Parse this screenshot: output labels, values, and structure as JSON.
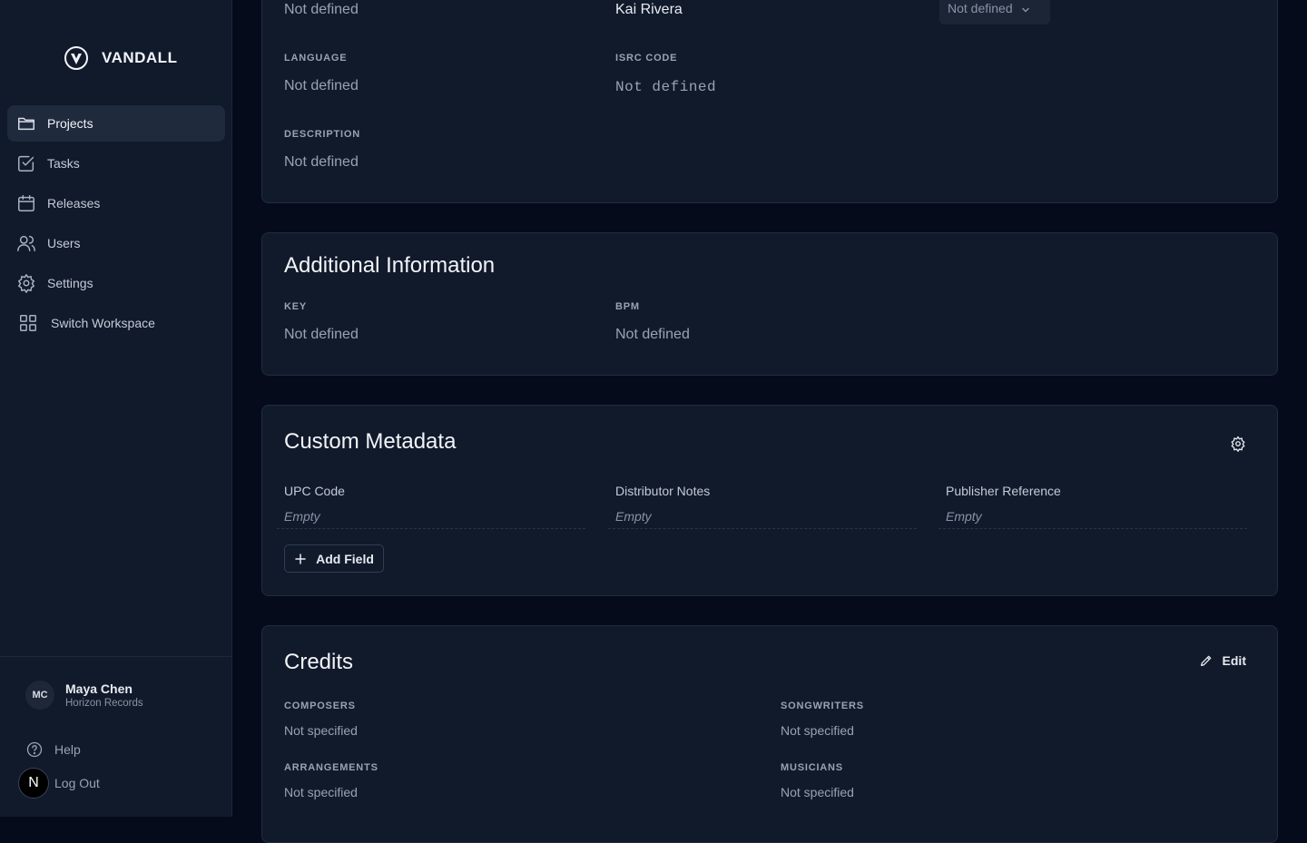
{
  "app": {
    "name": "VANDALL"
  },
  "sidebar": {
    "items": [
      {
        "label": "Projects",
        "icon": "folder-icon",
        "active": true
      },
      {
        "label": "Tasks",
        "icon": "checkbox-icon"
      },
      {
        "label": "Releases",
        "icon": "calendar-icon"
      },
      {
        "label": "Users",
        "icon": "users-icon"
      },
      {
        "label": "Settings",
        "icon": "gear-icon"
      },
      {
        "label": "Switch Workspace",
        "icon": "grid-icon"
      }
    ],
    "user": {
      "initials": "MC",
      "name": "Maya Chen",
      "org": "Horizon Records"
    },
    "help_label": "Help",
    "logout_label": "Log Out",
    "badge": "N"
  },
  "details": {
    "top_row": {
      "col1": "Not defined",
      "col2": "Kai Rivera",
      "select": "Not defined"
    },
    "language": {
      "label": "LANGUAGE",
      "value": "Not defined"
    },
    "isrc": {
      "label": "ISRC CODE",
      "value": "Not defined"
    },
    "description": {
      "label": "DESCRIPTION",
      "value": "Not defined"
    }
  },
  "additional": {
    "title": "Additional Information",
    "key": {
      "label": "KEY",
      "value": "Not defined"
    },
    "bpm": {
      "label": "BPM",
      "value": "Not defined"
    }
  },
  "custom": {
    "title": "Custom Metadata",
    "fields": [
      {
        "label": "UPC Code",
        "value": "Empty"
      },
      {
        "label": "Distributor Notes",
        "value": "Empty"
      },
      {
        "label": "Publisher Reference",
        "value": "Empty"
      }
    ],
    "add_label": "Add Field"
  },
  "credits": {
    "title": "Credits",
    "edit_label": "Edit",
    "composers": {
      "label": "COMPOSERS",
      "value": "Not specified"
    },
    "songwriters": {
      "label": "SONGWRITERS",
      "value": "Not specified"
    },
    "arrangements": {
      "label": "ARRANGEMENTS",
      "value": "Not specified"
    },
    "musicians": {
      "label": "MUSICIANS",
      "value": "Not specified"
    }
  }
}
